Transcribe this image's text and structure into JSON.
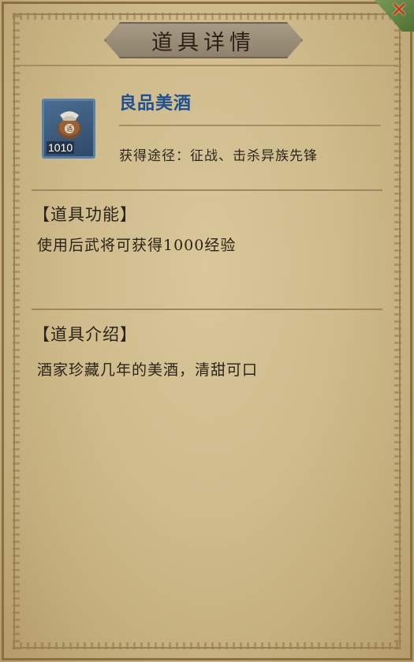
{
  "window": {
    "title": "道具详情",
    "close_icon": "close-icon"
  },
  "item": {
    "name": "良品美酒",
    "count": "1010",
    "icon": "wine-jar-icon",
    "source": "获得途径：征战、击杀异族先锋"
  },
  "sections": {
    "function": {
      "heading": "【道具功能】",
      "body": "使用后武将可获得1000经验"
    },
    "intro": {
      "heading": "【道具介绍】",
      "body": "酒家珍藏几年的美酒，清甜可口"
    }
  },
  "colors": {
    "item_name": "#1e4f8f",
    "parchment": "#cfbb8c",
    "icon_frame": "#5a7fa8",
    "close_x": "#c73a1e"
  }
}
